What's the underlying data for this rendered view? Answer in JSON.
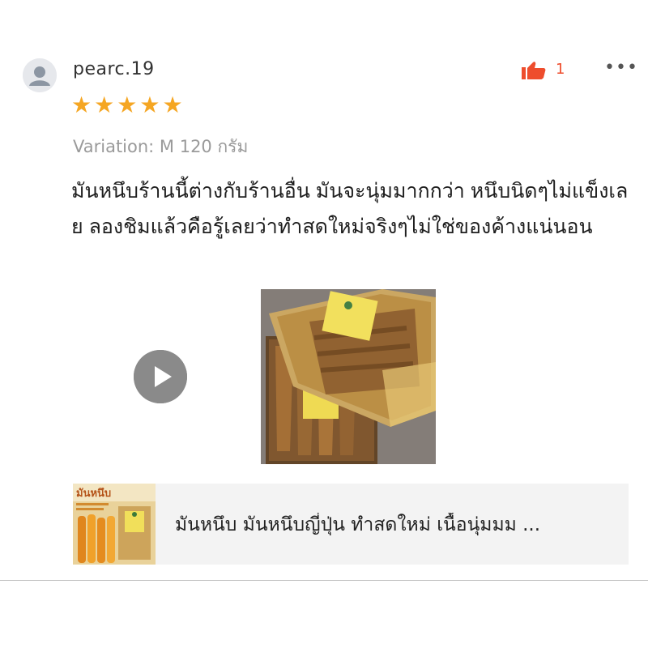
{
  "review": {
    "username": "pearc.19",
    "rating": 5,
    "like_count": "1",
    "variation": "Variation: M 120 กรัม",
    "text": "มันหนึบร้านนี้ต่างกับร้านอื่น มันจะนุ่มมากกว่า หนึบนิดๆไม่แข็งเลย ลองชิมแล้วคือรู้เลยว่าทำสดใหม่จริงๆไม่ใช่ของค้างแน่นอน",
    "more_label": "•••"
  },
  "product": {
    "title": "มันหนึบ มันหนึบญี่ปุ่น ทำสดใหม่ เนื้อนุ่มมม ...",
    "thumb_label": "มันหนึบ"
  },
  "colors": {
    "star": "#f5a623",
    "accent": "#ee4d2d",
    "play": "#8a8a8a"
  },
  "icons": {
    "avatar": "user-avatar-icon",
    "like": "thumbs-up-icon",
    "more": "more-horizontal-icon",
    "play": "play-icon"
  }
}
